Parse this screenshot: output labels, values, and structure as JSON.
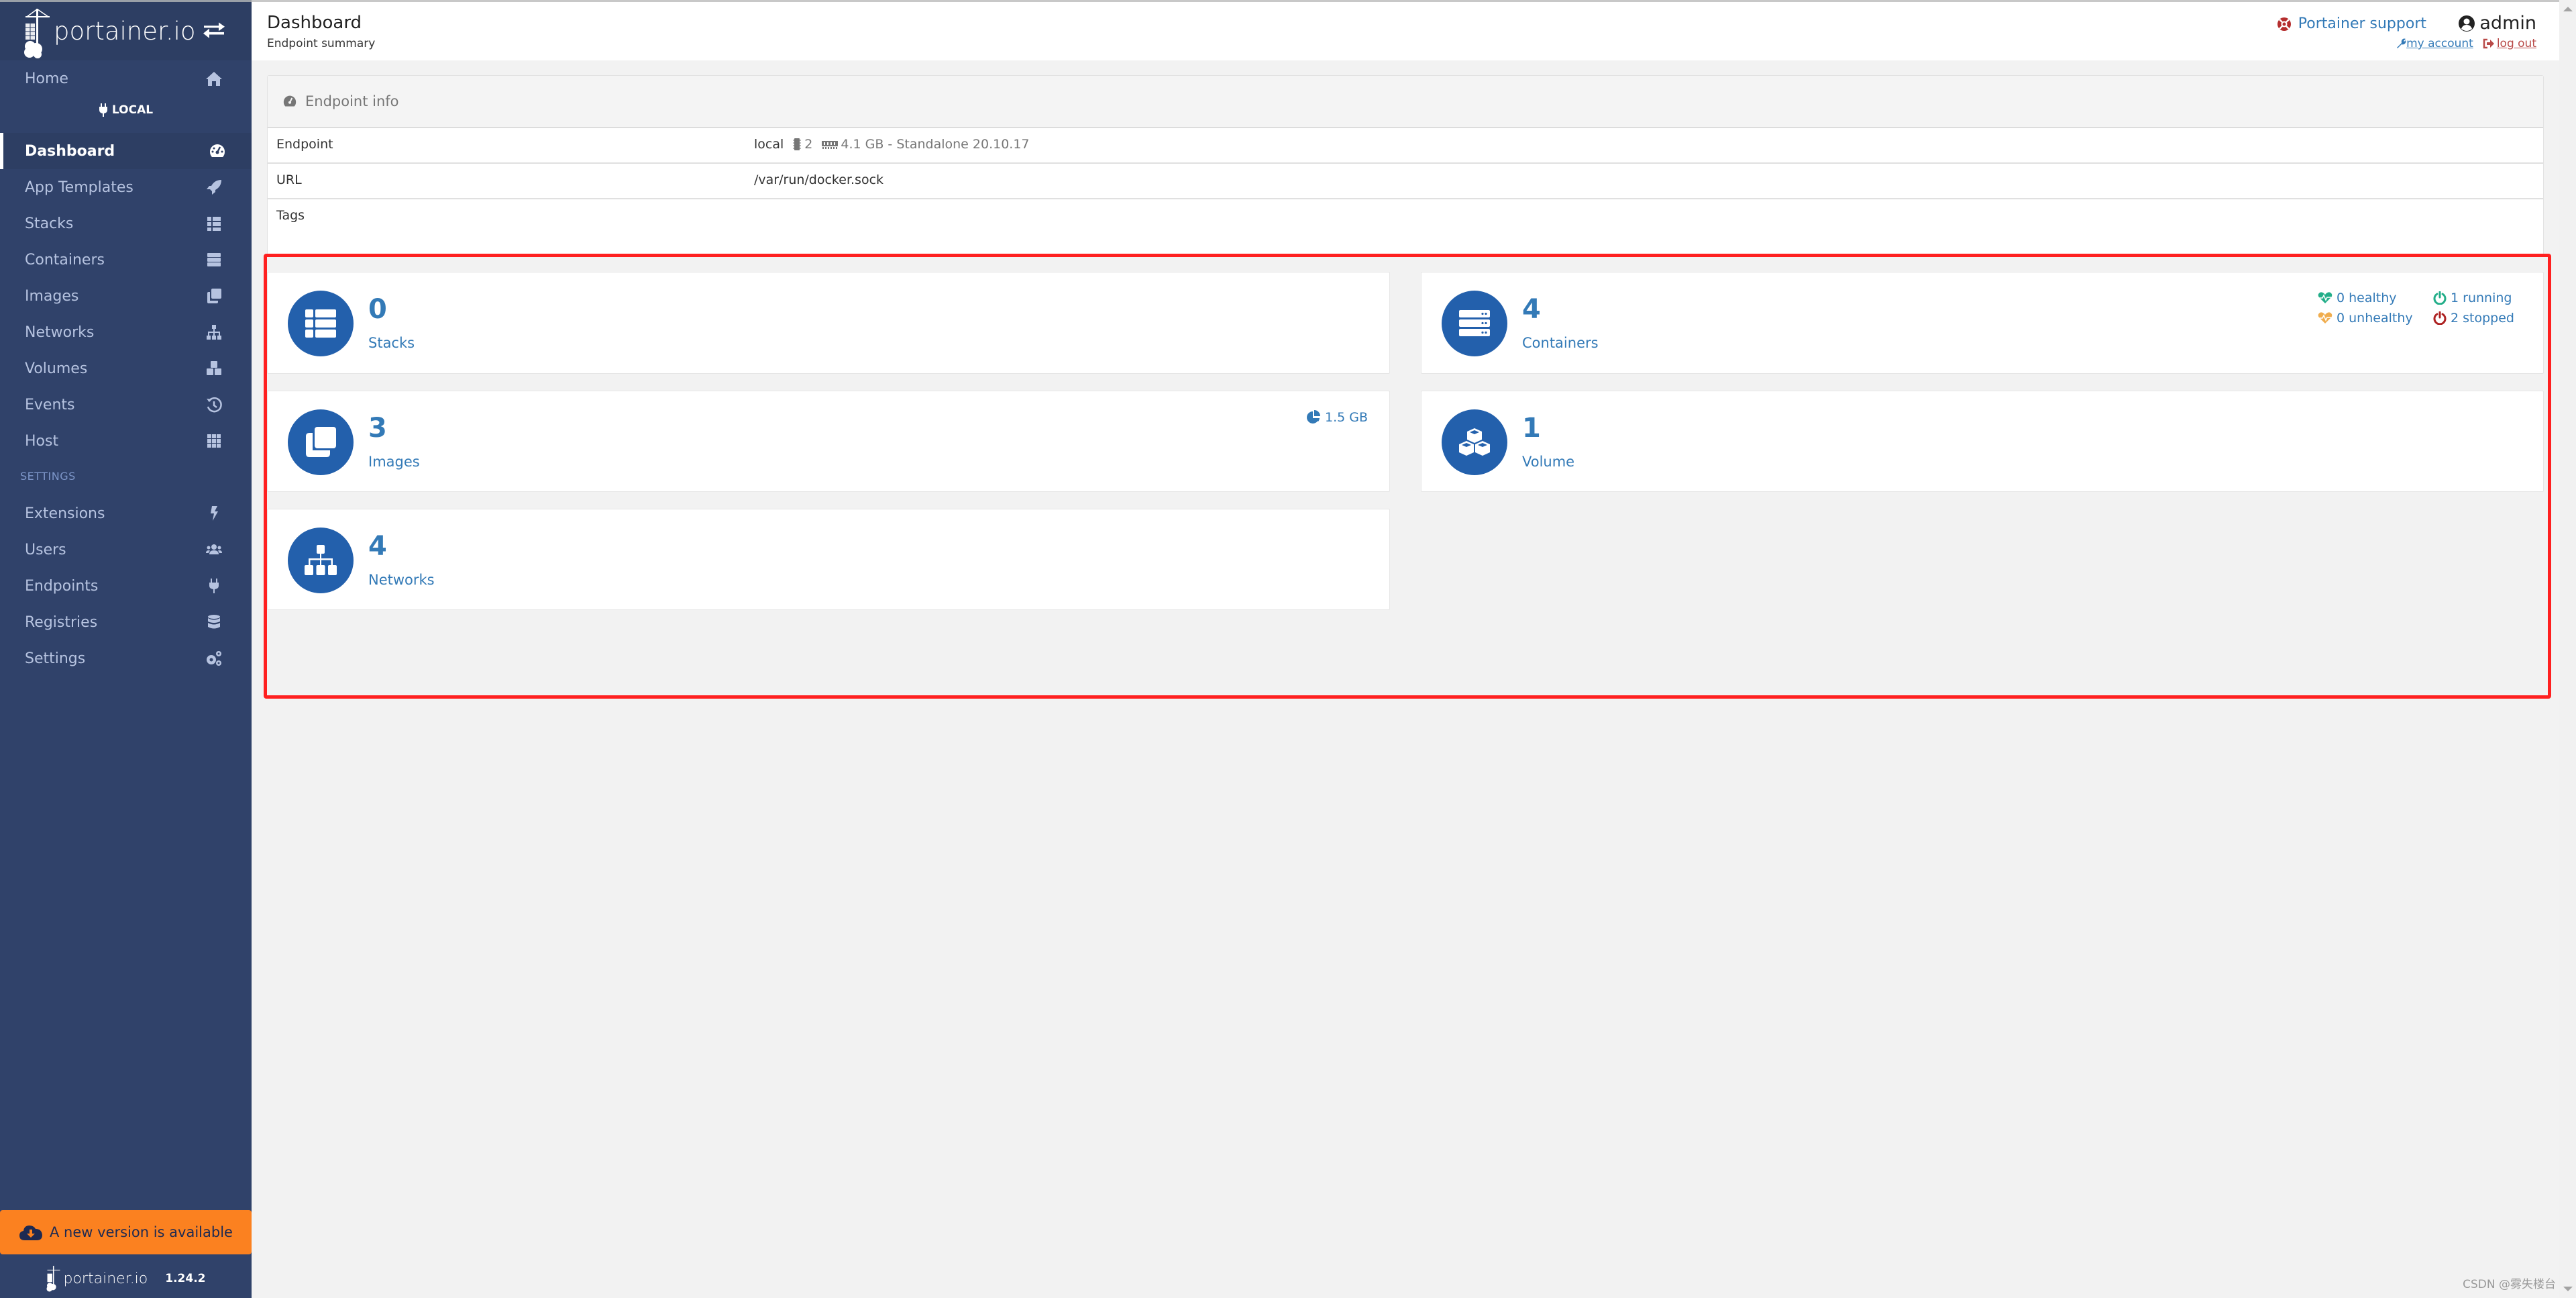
{
  "sidebar": {
    "brand": "portainer.io",
    "endpoint_label": "LOCAL",
    "items": [
      {
        "label": "Home",
        "icon": "home-icon"
      },
      {
        "label": "Dashboard",
        "icon": "tachometer-icon",
        "active": true
      },
      {
        "label": "App Templates",
        "icon": "rocket-icon"
      },
      {
        "label": "Stacks",
        "icon": "th-list-icon"
      },
      {
        "label": "Containers",
        "icon": "server-icon"
      },
      {
        "label": "Images",
        "icon": "clone-icon"
      },
      {
        "label": "Networks",
        "icon": "sitemap-icon"
      },
      {
        "label": "Volumes",
        "icon": "cubes-icon"
      },
      {
        "label": "Events",
        "icon": "history-icon"
      },
      {
        "label": "Host",
        "icon": "th-icon"
      }
    ],
    "settings_section": "SETTINGS",
    "settings_items": [
      {
        "label": "Extensions",
        "icon": "bolt-icon"
      },
      {
        "label": "Users",
        "icon": "users-icon"
      },
      {
        "label": "Endpoints",
        "icon": "plug-icon"
      },
      {
        "label": "Registries",
        "icon": "database-icon"
      },
      {
        "label": "Settings",
        "icon": "cogs-icon"
      }
    ],
    "update_banner": "A new version is available",
    "footer_brand": "portainer.io",
    "version": "1.24.2"
  },
  "header": {
    "title": "Dashboard",
    "subtitle": "Endpoint summary",
    "support_link": "Portainer support",
    "username": "admin",
    "my_account": "my account",
    "log_out": "log out"
  },
  "endpoint_info": {
    "title": "Endpoint info",
    "rows": [
      {
        "key": "Endpoint",
        "value": "local",
        "cpu": "2",
        "memory": "4.1 GB - Standalone 20.10.17"
      },
      {
        "key": "URL",
        "value": "/var/run/docker.sock"
      },
      {
        "key": "Tags",
        "value": ""
      }
    ]
  },
  "stats": {
    "stacks": {
      "count": "0",
      "label": "Stacks"
    },
    "containers": {
      "count": "4",
      "label": "Containers",
      "healthy": "0 healthy",
      "unhealthy": "0 unhealthy",
      "running": "1 running",
      "stopped": "2 stopped"
    },
    "images": {
      "count": "3",
      "label": "Images",
      "size": "1.5 GB"
    },
    "volumes": {
      "count": "1",
      "label": "Volume"
    },
    "networks": {
      "count": "4",
      "label": "Networks"
    }
  },
  "colors": {
    "sidebar_bg": "#30426a",
    "accent": "#337ab7",
    "icon_circle": "#2360ac",
    "update_banner": "#fb8120",
    "highlight_border": "#ff2020",
    "healthy": "#23ae89",
    "unhealthy": "#f0ad4e",
    "stopped": "#ae2323"
  },
  "watermark": "CSDN @雾失楼台"
}
